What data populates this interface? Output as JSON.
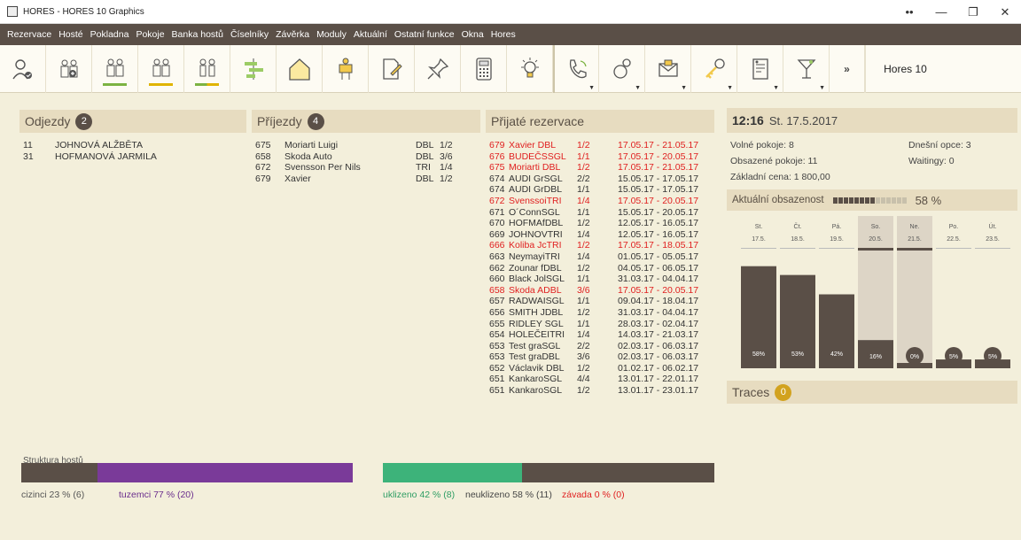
{
  "window": {
    "title": "HORES - HORES 10 Graphics",
    "controls": [
      "••",
      "—",
      "❐",
      "✕"
    ]
  },
  "menu": [
    "Rezervace",
    "Hosté",
    "Pokladna",
    "Pokoje",
    "Banka hostů",
    "Číselníky",
    "Závěrka",
    "Moduly",
    "Aktuální",
    "Ostatní funkce",
    "Okna",
    "Hores"
  ],
  "toolbar": {
    "buttons": [
      {
        "icon": "guest-checkin-icon"
      },
      {
        "icon": "guest-group-icon"
      },
      {
        "icon": "guests-green-icon",
        "accent": "#7cb342"
      },
      {
        "icon": "guests-yellow-icon",
        "accent": "#e0b400"
      },
      {
        "icon": "guests-pair-icon",
        "accent": "#7cb342"
      },
      {
        "icon": "timeline-icon"
      },
      {
        "icon": "house-icon"
      },
      {
        "icon": "housekeeper-icon"
      },
      {
        "icon": "edit-document-icon"
      },
      {
        "icon": "pin-icon"
      },
      {
        "icon": "calculator-icon"
      },
      {
        "icon": "lightbulb-icon"
      },
      {
        "icon": "phone-icon"
      },
      {
        "icon": "wake-up-icon"
      },
      {
        "icon": "mail-icon"
      },
      {
        "icon": "key-icon"
      },
      {
        "icon": "report-icon"
      },
      {
        "icon": "bar-glass-icon"
      },
      {
        "icon": "more-icon",
        "label": "»"
      }
    ],
    "hores_label": "Hores 10"
  },
  "departures": {
    "title": "Odjezdy",
    "count": "2",
    "rows": [
      {
        "room": "11",
        "name": "JOHNOVÁ ALŽBĚTA"
      },
      {
        "room": "31",
        "name": "HOFMANOVÁ JARMILA"
      }
    ]
  },
  "arrivals": {
    "title": "Příjezdy",
    "count": "4",
    "rows": [
      {
        "room": "675",
        "name": "Moriarti Luigi",
        "type": "DBL",
        "occ": "1/2"
      },
      {
        "room": "658",
        "name": "Skoda Auto",
        "type": "DBL",
        "occ": "3/6"
      },
      {
        "room": "672",
        "name": "Svensson Per Nils",
        "type": "TRI",
        "occ": "1/4"
      },
      {
        "room": "679",
        "name": "Xavier",
        "type": "DBL",
        "occ": "1/2"
      }
    ]
  },
  "reservations": {
    "title": "Přijaté rezervace",
    "rows": [
      {
        "id": "679",
        "name": "Xavier  DBL",
        "occ": "1/2",
        "dates": "17.05.17 - 21.05.17",
        "highlight": true
      },
      {
        "id": "676",
        "name": "BUDEČSSGL",
        "occ": "1/1",
        "dates": "17.05.17 - 20.05.17",
        "highlight": true
      },
      {
        "id": "675",
        "name": "Moriarti DBL",
        "occ": "1/2",
        "dates": "17.05.17 - 21.05.17",
        "highlight": true
      },
      {
        "id": "674",
        "name": "AUDI GrSGL",
        "occ": "2/2",
        "dates": "15.05.17 - 17.05.17",
        "highlight": false
      },
      {
        "id": "674",
        "name": "AUDI GrDBL",
        "occ": "1/1",
        "dates": "15.05.17 - 17.05.17",
        "highlight": false
      },
      {
        "id": "672",
        "name": "SvenssoiTRI",
        "occ": "1/4",
        "dates": "17.05.17 - 20.05.17",
        "highlight": true
      },
      {
        "id": "671",
        "name": "O´ConnSGL",
        "occ": "1/1",
        "dates": "15.05.17 - 20.05.17",
        "highlight": false
      },
      {
        "id": "670",
        "name": "HOFMAfDBL",
        "occ": "1/2",
        "dates": "12.05.17 - 16.05.17",
        "highlight": false
      },
      {
        "id": "669",
        "name": "JOHNOVTRI",
        "occ": "1/4",
        "dates": "12.05.17 - 16.05.17",
        "highlight": false
      },
      {
        "id": "666",
        "name": "Koliba JcTRI",
        "occ": "1/2",
        "dates": "17.05.17 - 18.05.17",
        "highlight": true
      },
      {
        "id": "663",
        "name": "NeymayiTRI",
        "occ": "1/4",
        "dates": "01.05.17 - 05.05.17",
        "highlight": false
      },
      {
        "id": "662",
        "name": "Zounar fDBL",
        "occ": "1/2",
        "dates": "04.05.17 - 06.05.17",
        "highlight": false
      },
      {
        "id": "660",
        "name": "Black JolSGL",
        "occ": "1/1",
        "dates": "31.03.17 - 04.04.17",
        "highlight": false
      },
      {
        "id": "658",
        "name": "Skoda ADBL",
        "occ": "3/6",
        "dates": "17.05.17 - 20.05.17",
        "highlight": true
      },
      {
        "id": "657",
        "name": "RADWAISGL",
        "occ": "1/1",
        "dates": "09.04.17 - 18.04.17",
        "highlight": false
      },
      {
        "id": "656",
        "name": "SMITH JDBL",
        "occ": "1/2",
        "dates": "31.03.17 - 04.04.17",
        "highlight": false
      },
      {
        "id": "655",
        "name": "RIDLEY SGL",
        "occ": "1/1",
        "dates": "28.03.17 - 02.04.17",
        "highlight": false
      },
      {
        "id": "654",
        "name": "HOLEČEITRI",
        "occ": "1/4",
        "dates": "14.03.17 - 21.03.17",
        "highlight": false
      },
      {
        "id": "653",
        "name": "Test graSGL",
        "occ": "2/2",
        "dates": "02.03.17 - 06.03.17",
        "highlight": false
      },
      {
        "id": "653",
        "name": "Test graDBL",
        "occ": "3/6",
        "dates": "02.03.17 - 06.03.17",
        "highlight": false
      },
      {
        "id": "652",
        "name": "Václavik DBL",
        "occ": "1/2",
        "dates": "01.02.17 - 06.02.17",
        "highlight": false
      },
      {
        "id": "651",
        "name": "KankaroSGL",
        "occ": "4/4",
        "dates": "13.01.17 - 22.01.17",
        "highlight": false
      },
      {
        "id": "651",
        "name": "KankaroSGL",
        "occ": "1/2",
        "dates": "13.01.17 - 23.01.17",
        "highlight": false
      }
    ]
  },
  "status": {
    "time": "12:16",
    "date": "St. 17.5.2017",
    "free_rooms": "Volné pokoje: 8",
    "occupied_rooms": "Obsazené pokoje: 11",
    "base_price": "Základní cena: 1 800,00",
    "today_options": "Dnešní opce: 3",
    "waitings": "Waitingy: 0"
  },
  "occupancy": {
    "label": "Aktuální obsazenost",
    "value": "58 %",
    "fraction": 0.58
  },
  "chart_data": {
    "type": "bar",
    "categories": [
      "St. 17.5.",
      "Čt. 18.5.",
      "Pá. 19.5.",
      "So. 20.5.",
      "Ne. 21.5.",
      "Po. 22.5.",
      "Út. 23.5."
    ],
    "days": [
      "St.",
      "Čt.",
      "Pá.",
      "So.",
      "Ne.",
      "Po.",
      "Út."
    ],
    "dates": [
      "17.5.",
      "18.5.",
      "19.5.",
      "20.5.",
      "21.5.",
      "22.5.",
      "23.5."
    ],
    "values": [
      58,
      53,
      42,
      16,
      0,
      5,
      5
    ],
    "labels": [
      "58%",
      "53%",
      "42%",
      "16%",
      "0%",
      "5%",
      "5%"
    ],
    "weekend": [
      false,
      false,
      false,
      true,
      true,
      false,
      false
    ],
    "ylim": [
      0,
      100
    ]
  },
  "traces": {
    "title": "Traces",
    "count": "0"
  },
  "guest_structure": {
    "title": "Struktura hostů",
    "foreigners_label": "cizinci 23 % (6)",
    "foreigners_fraction": 0.23,
    "domestic_label": "tuzemci 77 % (20)",
    "domestic_fraction": 0.77
  },
  "cleaning": {
    "cleaned_label": "uklizeno 42 % (8)",
    "cleaned_fraction": 0.42,
    "not_cleaned_label": "neuklizeno 58 % (11)",
    "not_cleaned_fraction": 0.58,
    "defect_label": "závada 0 % (0)"
  },
  "colors": {
    "menu_bg": "#5a4f47",
    "panel_hdr": "#e7dcc0",
    "highlight_red": "#e02020",
    "purple": "#7a3a99",
    "green": "#3db37a",
    "bar_dark": "#5a4f47",
    "badge_gold": "#d2a21e"
  }
}
